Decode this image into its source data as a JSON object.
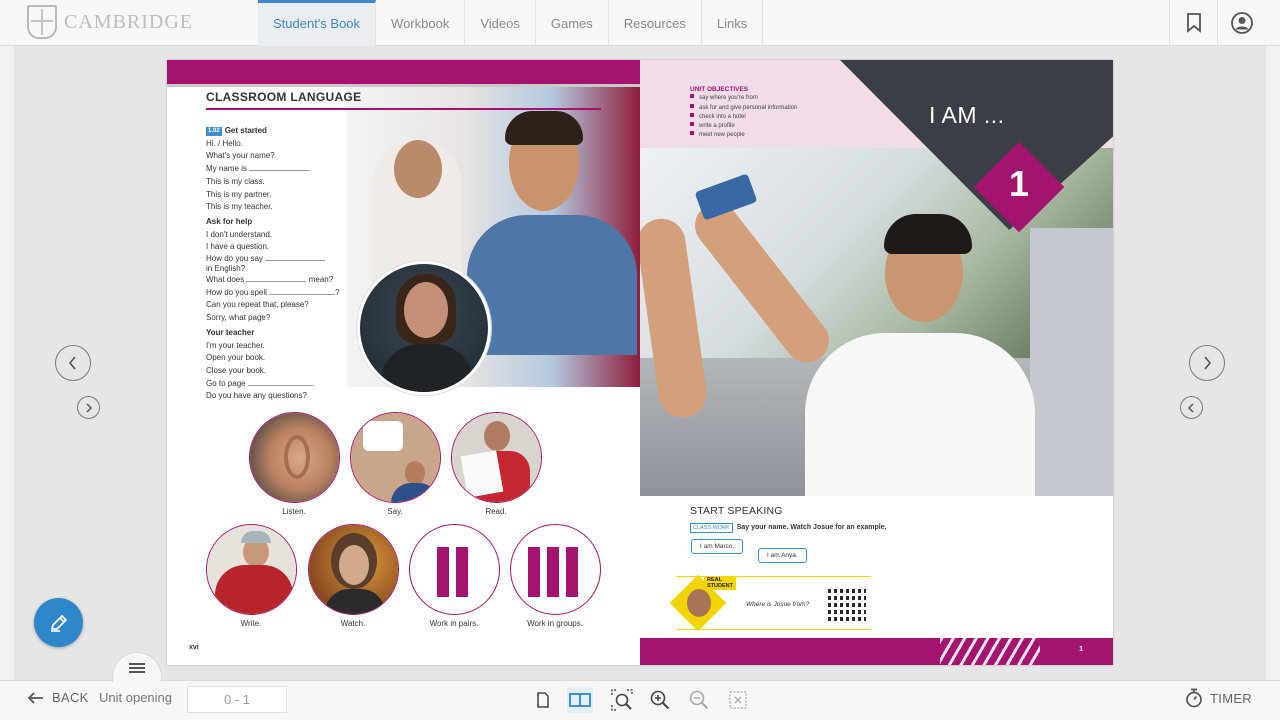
{
  "app": {
    "brand": "CAMBRIDGE"
  },
  "tabs": [
    {
      "label": "Student's Book",
      "active": true
    },
    {
      "label": "Workbook",
      "active": false
    },
    {
      "label": "Videos",
      "active": false
    },
    {
      "label": "Games",
      "active": false
    },
    {
      "label": "Resources",
      "active": false
    },
    {
      "label": "Links",
      "active": false
    }
  ],
  "top_icons": [
    "bookmark-icon",
    "user-account-icon"
  ],
  "left_page": {
    "title": "CLASSROOM LANGUAGE",
    "audio_track": "1.02",
    "sections": [
      {
        "heading": "Get started",
        "lines": [
          "Hi. / Hello.",
          "What's your name?",
          "My name is",
          "This is my class.",
          "This is my partner.",
          "This is my teacher."
        ]
      },
      {
        "heading": "Ask for help",
        "lines": [
          "I don't understand.",
          "I have a question.",
          "How do you say",
          "in English?",
          "What does",
          "mean?",
          "How do you spell",
          "?",
          "Can you repeat that, please?",
          "Sorry, what page?"
        ]
      },
      {
        "heading": "Your teacher",
        "lines": [
          "I'm your teacher.",
          "Open your book.",
          "Close your book.",
          "Go to page",
          "Do you have any questions?"
        ]
      }
    ],
    "circle_labels": [
      "Listen.",
      "Say.",
      "Read.",
      "Write.",
      "Watch.",
      "Work in pairs.",
      "Work in groups."
    ],
    "page_number": "xvi"
  },
  "right_page": {
    "objectives_title": "UNIT OBJECTIVES",
    "objectives": [
      "say where you're from",
      "ask for and give personal information",
      "check into a hotel",
      "write a profile",
      "meet new people"
    ],
    "unit_title": "I AM ...",
    "unit_number": "1",
    "start_speaking": "START SPEAKING",
    "class_work_tag": "CLASS WORK",
    "instruction": "Say your name. Watch Josue for an example.",
    "bubble1": "I am Marco.",
    "bubble2": "I am Anya.",
    "real_student_tag_line1": "REAL",
    "real_student_tag_line2": "STUDENT",
    "real_student_question": "Where is Josue from?",
    "page_number": "1"
  },
  "bottom": {
    "back_label": "BACK",
    "unit_label": "Unit opening",
    "page_range": "0 - 1",
    "timer_label": "TIMER"
  },
  "colors": {
    "accent": "#3f88c7",
    "magenta": "#a3136f",
    "pencil": "#2f86c8"
  }
}
